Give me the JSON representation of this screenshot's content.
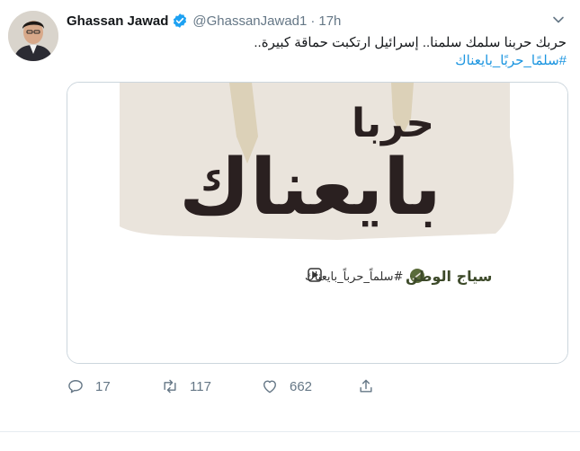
{
  "tweet": {
    "author_name": "Ghassan Jawad",
    "author_handle": "@GhassanJawad1",
    "separator": "·",
    "time": "17h",
    "text_line1": "حربك حربنا سلمك سلمنا.. إسرائيل ارتكبت حماقة كبيرة..",
    "hashtag": "#سلمًا_حربًا_بايعناك",
    "media": {
      "headline_small": "حربا",
      "headline_big": "بايعناك",
      "brand": "سياج الوطن",
      "brand_hashtag": "#سلماً_حرباً_بايعناك",
      "bg_color": "#eae4dc",
      "text_color": "#2a2020"
    },
    "actions": {
      "reply_count": "17",
      "retweet_count": "117",
      "like_count": "662"
    }
  },
  "colors": {
    "accent": "#1b95e0",
    "muted": "#657786",
    "verified": "#1da1f2"
  }
}
